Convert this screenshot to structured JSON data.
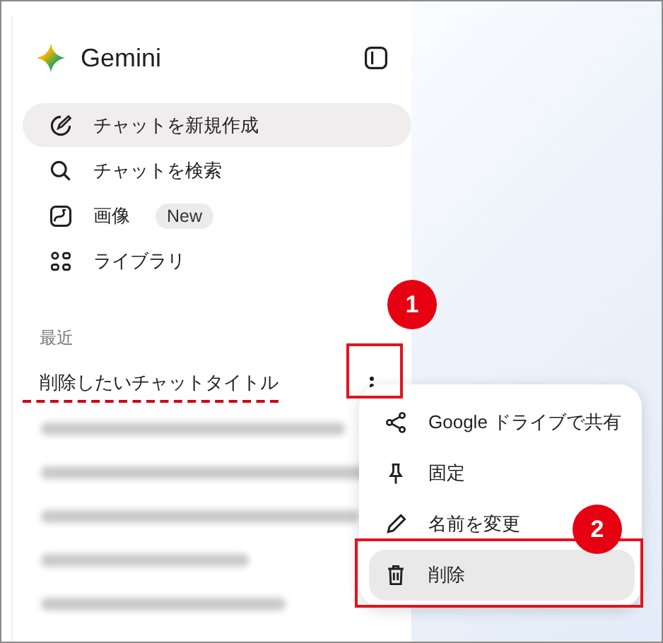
{
  "app": {
    "title": "Gemini"
  },
  "nav": [
    {
      "kind": "new-chat",
      "label": "チャットを新規作成",
      "selected": true
    },
    {
      "kind": "search",
      "label": "チャットを検索",
      "selected": false
    },
    {
      "kind": "image",
      "label": "画像",
      "badge": "New",
      "selected": false
    },
    {
      "kind": "library",
      "label": "ライブラリ",
      "selected": false
    }
  ],
  "recent": {
    "heading": "最近",
    "items": [
      {
        "kind": "chat",
        "title": "削除したいチャットタイトル",
        "marked": true
      },
      {
        "kind": "blurred"
      },
      {
        "kind": "blurred"
      },
      {
        "kind": "blurred"
      },
      {
        "kind": "blurred"
      },
      {
        "kind": "blurred"
      }
    ]
  },
  "context_menu": {
    "items": [
      {
        "kind": "share",
        "label": "Google ドライブで共有",
        "selected": false
      },
      {
        "kind": "pin",
        "label": "固定",
        "selected": false
      },
      {
        "kind": "rename",
        "label": "名前を変更",
        "selected": false
      },
      {
        "kind": "delete",
        "label": "削除",
        "selected": true
      }
    ]
  },
  "annotations": [
    {
      "number": "1"
    },
    {
      "number": "2"
    }
  ]
}
